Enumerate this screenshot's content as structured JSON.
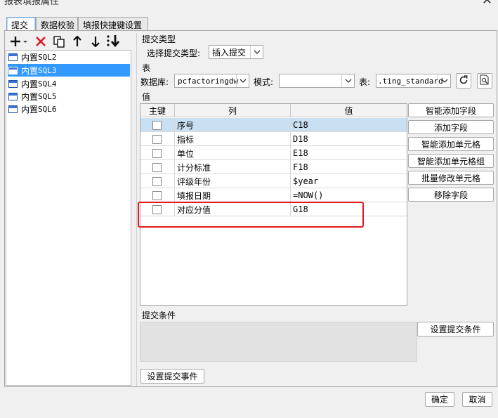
{
  "window": {
    "title": "报表填报属性",
    "close_glyph": "✕"
  },
  "tabs": [
    {
      "label": "提交",
      "active": true
    },
    {
      "label": "数据校验",
      "active": false
    },
    {
      "label": "填报快捷键设置",
      "active": false
    }
  ],
  "toolbar": {
    "icons": [
      "add-dropdown-icon",
      "delete-icon",
      "copy-icon",
      "move-up-icon",
      "move-down-icon",
      "sort-icon"
    ]
  },
  "sql_list": [
    {
      "prefix": "内置",
      "suffix": "SQL2",
      "selected": false
    },
    {
      "prefix": "内置",
      "suffix": "SQL3",
      "selected": true
    },
    {
      "prefix": "内置",
      "suffix": "SQL4",
      "selected": false
    },
    {
      "prefix": "内置",
      "suffix": "SQL5",
      "selected": false
    },
    {
      "prefix": "内置",
      "suffix": "SQL6",
      "selected": false
    }
  ],
  "submit_type": {
    "section_label": "提交类型",
    "field_label": "选择提交类型:",
    "value": "插入提交"
  },
  "table_section": {
    "section_label": "表",
    "db_label": "数据库:",
    "db_value": "pcfactoringdw",
    "schema_label": "模式:",
    "schema_value": "",
    "table_label": "表:",
    "table_value": ".ting_standard"
  },
  "values_section": {
    "section_label": "值",
    "columns": [
      "主键",
      "列",
      "值"
    ],
    "rows": [
      {
        "column": "序号",
        "value": "C18",
        "checked": false,
        "selected": true
      },
      {
        "column": "指标",
        "value": "D18",
        "checked": false,
        "selected": false
      },
      {
        "column": "单位",
        "value": "E18",
        "checked": false,
        "selected": false
      },
      {
        "column": "计分标准",
        "value": "F18",
        "checked": false,
        "selected": false
      },
      {
        "column": "评级年份",
        "value": "$year",
        "checked": false,
        "selected": false
      },
      {
        "column": "填报日期",
        "value": "=NOW()",
        "checked": false,
        "selected": false
      },
      {
        "column": "对应分值",
        "value": "G18",
        "checked": false,
        "selected": false
      }
    ],
    "side_buttons": [
      "智能添加字段",
      "添加字段",
      "智能添加单元格",
      "智能添加单元格组",
      "批量修改单元格",
      "移除字段"
    ]
  },
  "condition_section": {
    "section_label": "提交条件",
    "set_condition_button": "设置提交条件"
  },
  "event_button": "设置提交事件",
  "footer": {
    "ok": "确定",
    "cancel": "取消"
  },
  "colors": {
    "selection": "#3399ff",
    "row_highlight": "#c9dff2",
    "annotation_red": "#e0191e"
  }
}
